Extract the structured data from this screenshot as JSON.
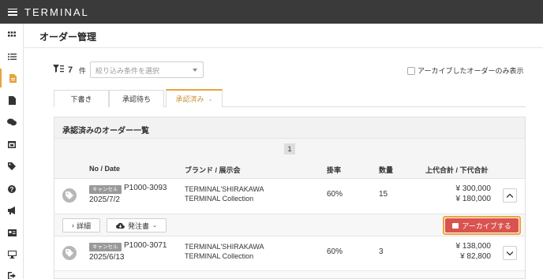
{
  "app": {
    "brand": "TERMINAL"
  },
  "page": {
    "title": "オーダー管理"
  },
  "filter": {
    "count": "7",
    "count_unit": "件",
    "placeholder": "絞り込み条件を選択",
    "archive_only_label": "アーカイブしたオーダーのみ表示"
  },
  "tabs": [
    {
      "label": "下書き"
    },
    {
      "label": "承認待ち"
    },
    {
      "label": "承認済み",
      "active": true
    }
  ],
  "panel": {
    "title": "承認済みのオーダー一覧",
    "page": "1",
    "columns": {
      "no_date": "No / Date",
      "brand": "ブランド / 展示会",
      "rate": "掛率",
      "qty": "数量",
      "total": "上代合計 / 下代合計"
    }
  },
  "orders": [
    {
      "status": "キャンセル",
      "no": "P1000-3093",
      "date": "2025/7/2",
      "brand": "TERMINAL'SHIRAKAWA",
      "exhibition": "TERMINAL Collection",
      "rate": "60%",
      "qty": "15",
      "retail_total": "¥ 300,000",
      "wholesale_total": "¥ 180,000",
      "expanded": true
    },
    {
      "status": "キャンセル",
      "no": "P1000-3071",
      "date": "2025/6/13",
      "brand": "TERMINAL'SHIRAKAWA",
      "exhibition": "TERMINAL Collection",
      "rate": "60%",
      "qty": "3",
      "retail_total": "¥ 138,000",
      "wholesale_total": "¥ 82,800",
      "expanded": false
    }
  ],
  "actions": {
    "detail": "詳細",
    "order_form": "発注書",
    "archive": "アーカイブする"
  },
  "colors": {
    "topbar": "#3a3a3a",
    "accent": "#e8a33d",
    "archive": "#d9534f"
  },
  "sidebar": {
    "icons": [
      "grid-icon",
      "checklist-icon",
      "order-doc-icon",
      "document-icon",
      "chat-icon",
      "calendar-icon",
      "tag-icon",
      "help-icon",
      "megaphone-icon",
      "id-card-icon",
      "monitor-icon",
      "logout-icon"
    ],
    "active": "order-doc-icon"
  }
}
